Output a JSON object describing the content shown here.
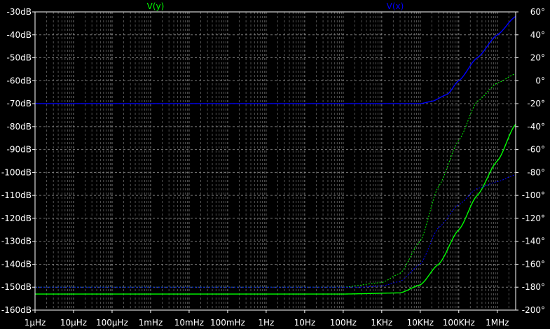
{
  "chart_data": {
    "type": "line",
    "x_scale": "log",
    "x_range_hz": [
      1e-06,
      3000000.0
    ],
    "x_ticks": [
      {
        "label": "1µHz",
        "value": 1e-06
      },
      {
        "label": "10µHz",
        "value": 1e-05
      },
      {
        "label": "100µHz",
        "value": 0.0001
      },
      {
        "label": "1mHz",
        "value": 0.001
      },
      {
        "label": "10mHz",
        "value": 0.01
      },
      {
        "label": "100mHz",
        "value": 0.1
      },
      {
        "label": "1Hz",
        "value": 1
      },
      {
        "label": "10Hz",
        "value": 10
      },
      {
        "label": "100Hz",
        "value": 100
      },
      {
        "label": "1KHz",
        "value": 1000.0
      },
      {
        "label": "10KHz",
        "value": 10000.0
      },
      {
        "label": "100KHz",
        "value": 100000.0
      },
      {
        "label": "1MHz",
        "value": 1000000.0
      }
    ],
    "y_left_range_db": [
      -160,
      -30
    ],
    "y_left_ticks": [
      {
        "label": "-30dB",
        "value": -30
      },
      {
        "label": "-40dB",
        "value": -40
      },
      {
        "label": "-50dB",
        "value": -50
      },
      {
        "label": "-60dB",
        "value": -60
      },
      {
        "label": "-70dB",
        "value": -70
      },
      {
        "label": "-80dB",
        "value": -80
      },
      {
        "label": "-90dB",
        "value": -90
      },
      {
        "label": "-100dB",
        "value": -100
      },
      {
        "label": "-110dB",
        "value": -110
      },
      {
        "label": "-120dB",
        "value": -120
      },
      {
        "label": "-130dB",
        "value": -130
      },
      {
        "label": "-140dB",
        "value": -140
      },
      {
        "label": "-150dB",
        "value": -150
      },
      {
        "label": "-160dB",
        "value": -160
      }
    ],
    "y_right_range_deg": [
      -200,
      60
    ],
    "y_right_ticks": [
      {
        "label": "60°",
        "value": 60
      },
      {
        "label": "40°",
        "value": 40
      },
      {
        "label": "20°",
        "value": 20
      },
      {
        "label": "0°",
        "value": 0
      },
      {
        "label": "-20°",
        "value": -20
      },
      {
        "label": "-40°",
        "value": -40
      },
      {
        "label": "-60°",
        "value": -60
      },
      {
        "label": "-80°",
        "value": -80
      },
      {
        "label": "-100°",
        "value": -100
      },
      {
        "label": "-120°",
        "value": -120
      },
      {
        "label": "-140°",
        "value": -140
      },
      {
        "label": "-160°",
        "value": -160
      },
      {
        "label": "-180°",
        "value": -180
      },
      {
        "label": "-200°",
        "value": -200
      }
    ],
    "grid": true,
    "series": [
      {
        "name": "V(y)",
        "color": "#00ff00",
        "magnitude_db": [
          [
            1e-06,
            -153
          ],
          [
            100,
            -153
          ],
          [
            3000,
            -152.5
          ],
          [
            10000,
            -149
          ],
          [
            30000,
            -140
          ],
          [
            100000,
            -125
          ],
          [
            300000,
            -110
          ],
          [
            1000000,
            -95
          ],
          [
            3000000,
            -79
          ]
        ],
        "phase_deg": [
          [
            1e-06,
            -180
          ],
          [
            100,
            -180
          ],
          [
            1000,
            -176
          ],
          [
            3000,
            -168
          ],
          [
            10000,
            -140
          ],
          [
            30000,
            -92
          ],
          [
            100000,
            -52
          ],
          [
            300000,
            -18
          ],
          [
            1000000,
            -2
          ],
          [
            3000000,
            6
          ]
        ]
      },
      {
        "name": "V(x)",
        "color": "#0000ff",
        "magnitude_db": [
          [
            1e-06,
            -70
          ],
          [
            10000,
            -70
          ],
          [
            20000,
            -69
          ],
          [
            50000,
            -66
          ],
          [
            100000,
            -60
          ],
          [
            300000,
            -50
          ],
          [
            1000000,
            -40
          ],
          [
            3000000,
            -32
          ]
        ],
        "phase_deg": [
          [
            1e-06,
            -180
          ],
          [
            300,
            -180
          ],
          [
            1000,
            -179
          ],
          [
            3000,
            -175
          ],
          [
            10000,
            -160
          ],
          [
            30000,
            -128
          ],
          [
            100000,
            -108
          ],
          [
            300000,
            -94
          ],
          [
            1000000,
            -88
          ],
          [
            3000000,
            -82
          ]
        ]
      }
    ]
  },
  "colors": {
    "background": "#000000",
    "axis": "#ffffff",
    "grid": "#888888"
  }
}
